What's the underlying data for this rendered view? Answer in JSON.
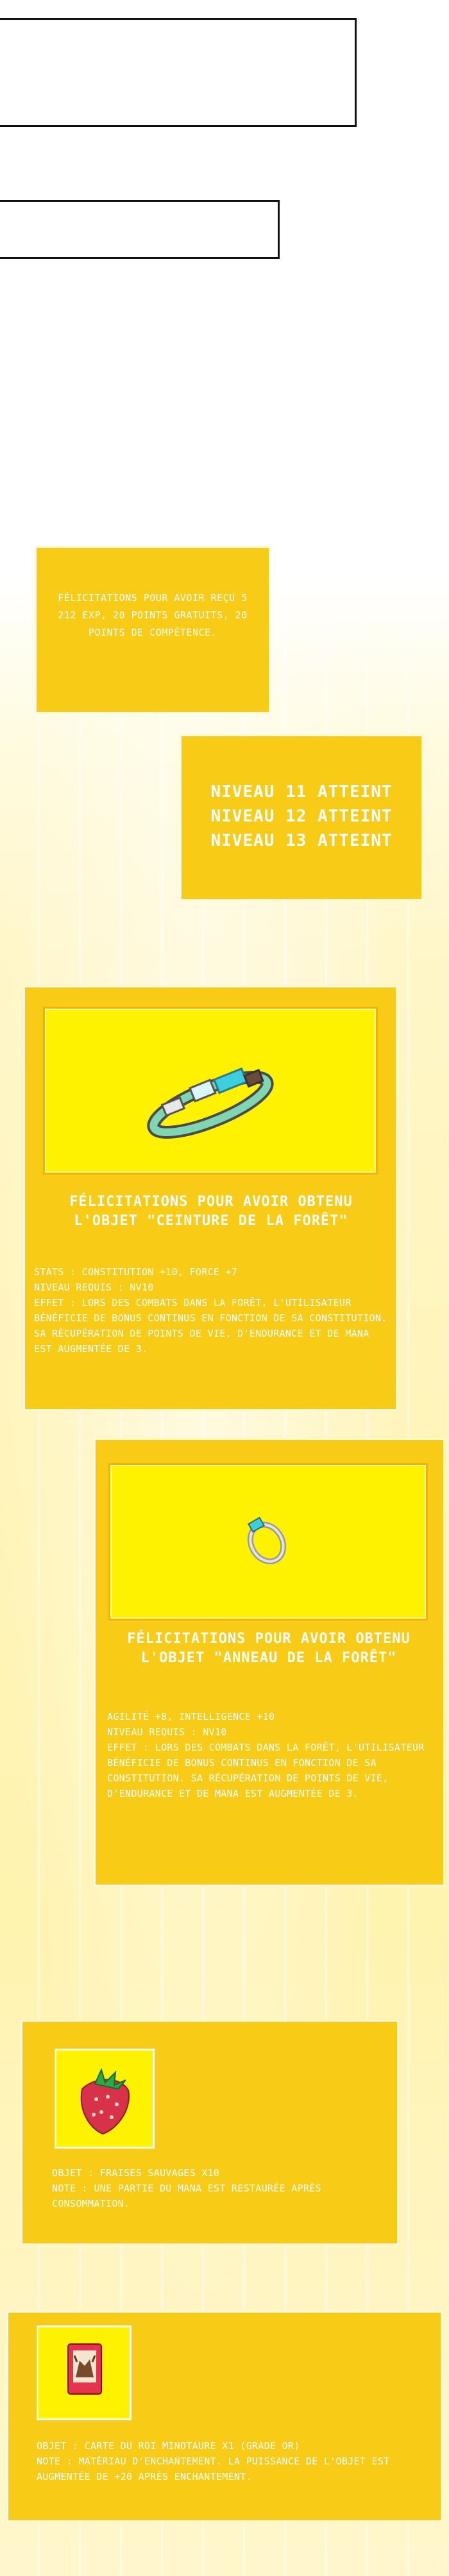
{
  "notifications": {
    "reward_message": "Félicitations pour avoir reçu 5 212 EXP, 20 points gratuits, 20 points de compétence.",
    "levels": [
      "Niveau 11 atteint",
      "Niveau 12 atteint",
      "Niveau 13 atteint"
    ]
  },
  "items": [
    {
      "title": "Félicitations pour avoir obtenu l'objet \"Ceinture de la forêt\"",
      "lines": [
        "Stats : Constitution +10, Force +7",
        "Niveau requis : Nv10",
        "Effet : Lors des combats dans la forêt, l'utilisateur bénéficie de bonus continus en fonction de sa constitution. Sa récupération de points de vie, d'endurance et de mana est augmentée de 3."
      ]
    },
    {
      "title": "Félicitations pour avoir obtenu l'objet \"Anneau de la forêt\"",
      "lines": [
        "Agilité +8, Intelligence +10",
        "Niveau requis : Nv10",
        "Effet : Lors des combats dans la forêt, l'utilisateur bénéficie de bonus continus en fonction de sa constitution. Sa récupération de points de vie, d'endurance et de mana est augmentée de 3."
      ]
    }
  ],
  "consumables": [
    {
      "lines": [
        "Objet : Fraises sauvages x10",
        "Note : Une partie du mana est restaurée après consommation."
      ]
    },
    {
      "lines": [
        "Objet : Carte du Roi Minotaure x1 (Grade Or)",
        "Note : Matériau d'enchantement. La puissance de l'objet est augmentée de +20 après enchantement."
      ]
    }
  ],
  "colors": {
    "panel": "#f8cc16",
    "item_image_bg": "#fff200",
    "text": "#ffffff"
  }
}
